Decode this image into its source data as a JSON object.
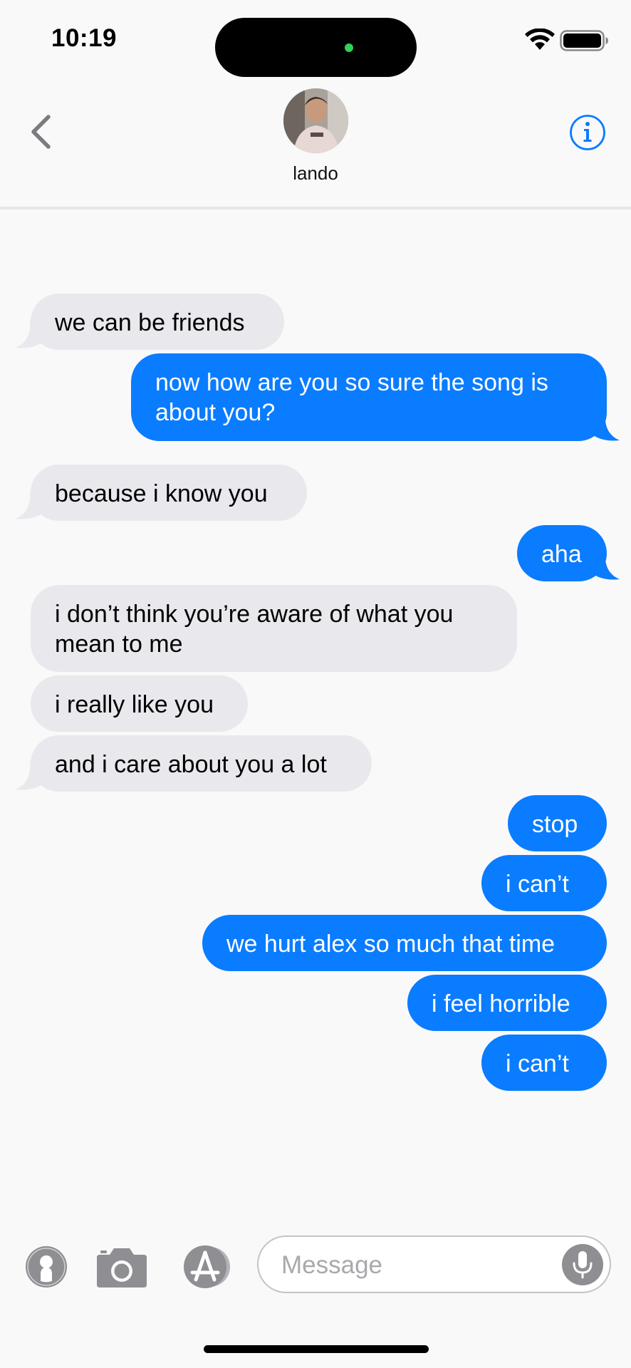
{
  "status_bar": {
    "time": "10:19"
  },
  "header": {
    "contact_name": "lando"
  },
  "messages": [
    {
      "text": "we can be friends",
      "from": "them"
    },
    {
      "text": "now how are you so sure the song is about you?",
      "from": "me"
    },
    {
      "text": "because i know you",
      "from": "them"
    },
    {
      "text": "aha",
      "from": "me"
    },
    {
      "text": "i don’t think you’re aware of what you mean to me",
      "from": "them"
    },
    {
      "text": "i really like you",
      "from": "them"
    },
    {
      "text": "and i care about you a lot",
      "from": "them"
    },
    {
      "text": "stop",
      "from": "me"
    },
    {
      "text": "i can’t",
      "from": "me"
    },
    {
      "text": "we hurt alex so much that time",
      "from": "me"
    },
    {
      "text": "i feel horrible",
      "from": "me"
    },
    {
      "text": "i can’t",
      "from": "me"
    }
  ],
  "composer": {
    "placeholder": "Message",
    "value": ""
  },
  "colors": {
    "outgoing": "#0a7cff",
    "incoming": "#e9e8ed",
    "accent": "#0a7cff"
  },
  "icons": [
    "back-chevron-icon",
    "info-icon",
    "contact-icon",
    "camera-icon",
    "app-store-icon",
    "microphone-icon"
  ]
}
